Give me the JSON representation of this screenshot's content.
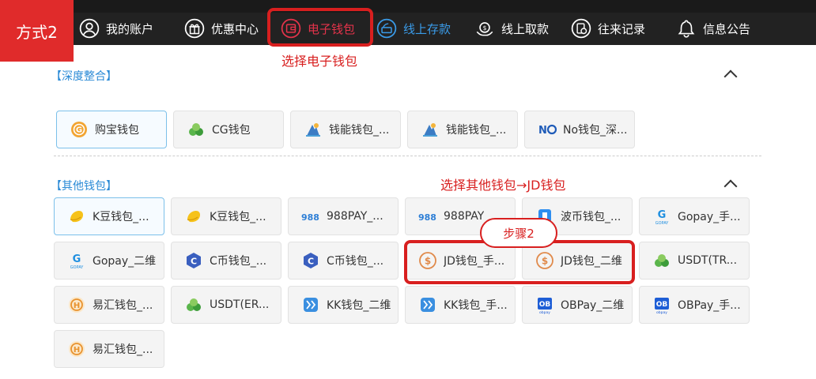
{
  "badge": "方式2",
  "nav": [
    {
      "label": "我的账户",
      "icon": "user-icon",
      "state": "normal"
    },
    {
      "label": "优惠中心",
      "icon": "gift-icon",
      "state": "normal"
    },
    {
      "label": "电子钱包",
      "icon": "wallet-icon",
      "state": "active"
    },
    {
      "label": "线上存款",
      "icon": "deposit-icon",
      "state": "highlight"
    },
    {
      "label": "线上取款",
      "icon": "withdraw-icon",
      "state": "normal"
    },
    {
      "label": "往来记录",
      "icon": "records-icon",
      "state": "normal"
    },
    {
      "label": "信息公告",
      "icon": "bell-icon",
      "state": "normal"
    }
  ],
  "notes": {
    "select_ewallet": "选择电子钱包",
    "select_jd": "选择其他钱包→JD钱包",
    "step2": "步骤2"
  },
  "sections": {
    "deep": "【深度整合】",
    "other": "【其他钱包】"
  },
  "deep_wallets": [
    {
      "label": "购宝钱包",
      "icon": "goubao-icon"
    },
    {
      "label": "CG钱包",
      "icon": "cg-icon"
    },
    {
      "label": "钱能钱包_...",
      "icon": "qianneng-icon"
    },
    {
      "label": "钱能钱包_...",
      "icon": "qianneng-icon"
    },
    {
      "label": "No钱包_深...",
      "icon": "no-icon"
    }
  ],
  "other_wallets": [
    {
      "label": "K豆钱包_...",
      "icon": "kdou-icon"
    },
    {
      "label": "K豆钱包_...",
      "icon": "kdou-icon"
    },
    {
      "label": "988PAY_...",
      "icon": "988pay-icon"
    },
    {
      "label": "988PAY",
      "icon": "988pay-icon"
    },
    {
      "label": "波币钱包_...",
      "icon": "bobi-icon"
    },
    {
      "label": "Gopay_手...",
      "icon": "gopay-icon"
    },
    {
      "label": "Gopay_二维",
      "icon": "gopay-icon"
    },
    {
      "label": "C币钱包_...",
      "icon": "cbi-icon"
    },
    {
      "label": "C币钱包_...",
      "icon": "cbi-icon"
    },
    {
      "label": "JD钱包_手...",
      "icon": "jd-icon"
    },
    {
      "label": "JD钱包_二维",
      "icon": "jd-icon"
    },
    {
      "label": "USDT(TR...",
      "icon": "usdt-icon"
    },
    {
      "label": "易汇钱包_...",
      "icon": "yihui-icon"
    },
    {
      "label": "USDT(ER...",
      "icon": "usdt-icon"
    },
    {
      "label": "KK钱包_二维",
      "icon": "kk-icon"
    },
    {
      "label": "KK钱包_手...",
      "icon": "kk-icon"
    },
    {
      "label": "OBPay_二维",
      "icon": "obpay-icon"
    },
    {
      "label": "OBPay_手...",
      "icon": "obpay-icon"
    },
    {
      "label": "易汇钱包_...",
      "icon": "yihui-icon"
    }
  ],
  "colors": {
    "accent_red": "#d81f1f",
    "link_blue": "#2a8ad6",
    "nav_bg": "#222222"
  }
}
